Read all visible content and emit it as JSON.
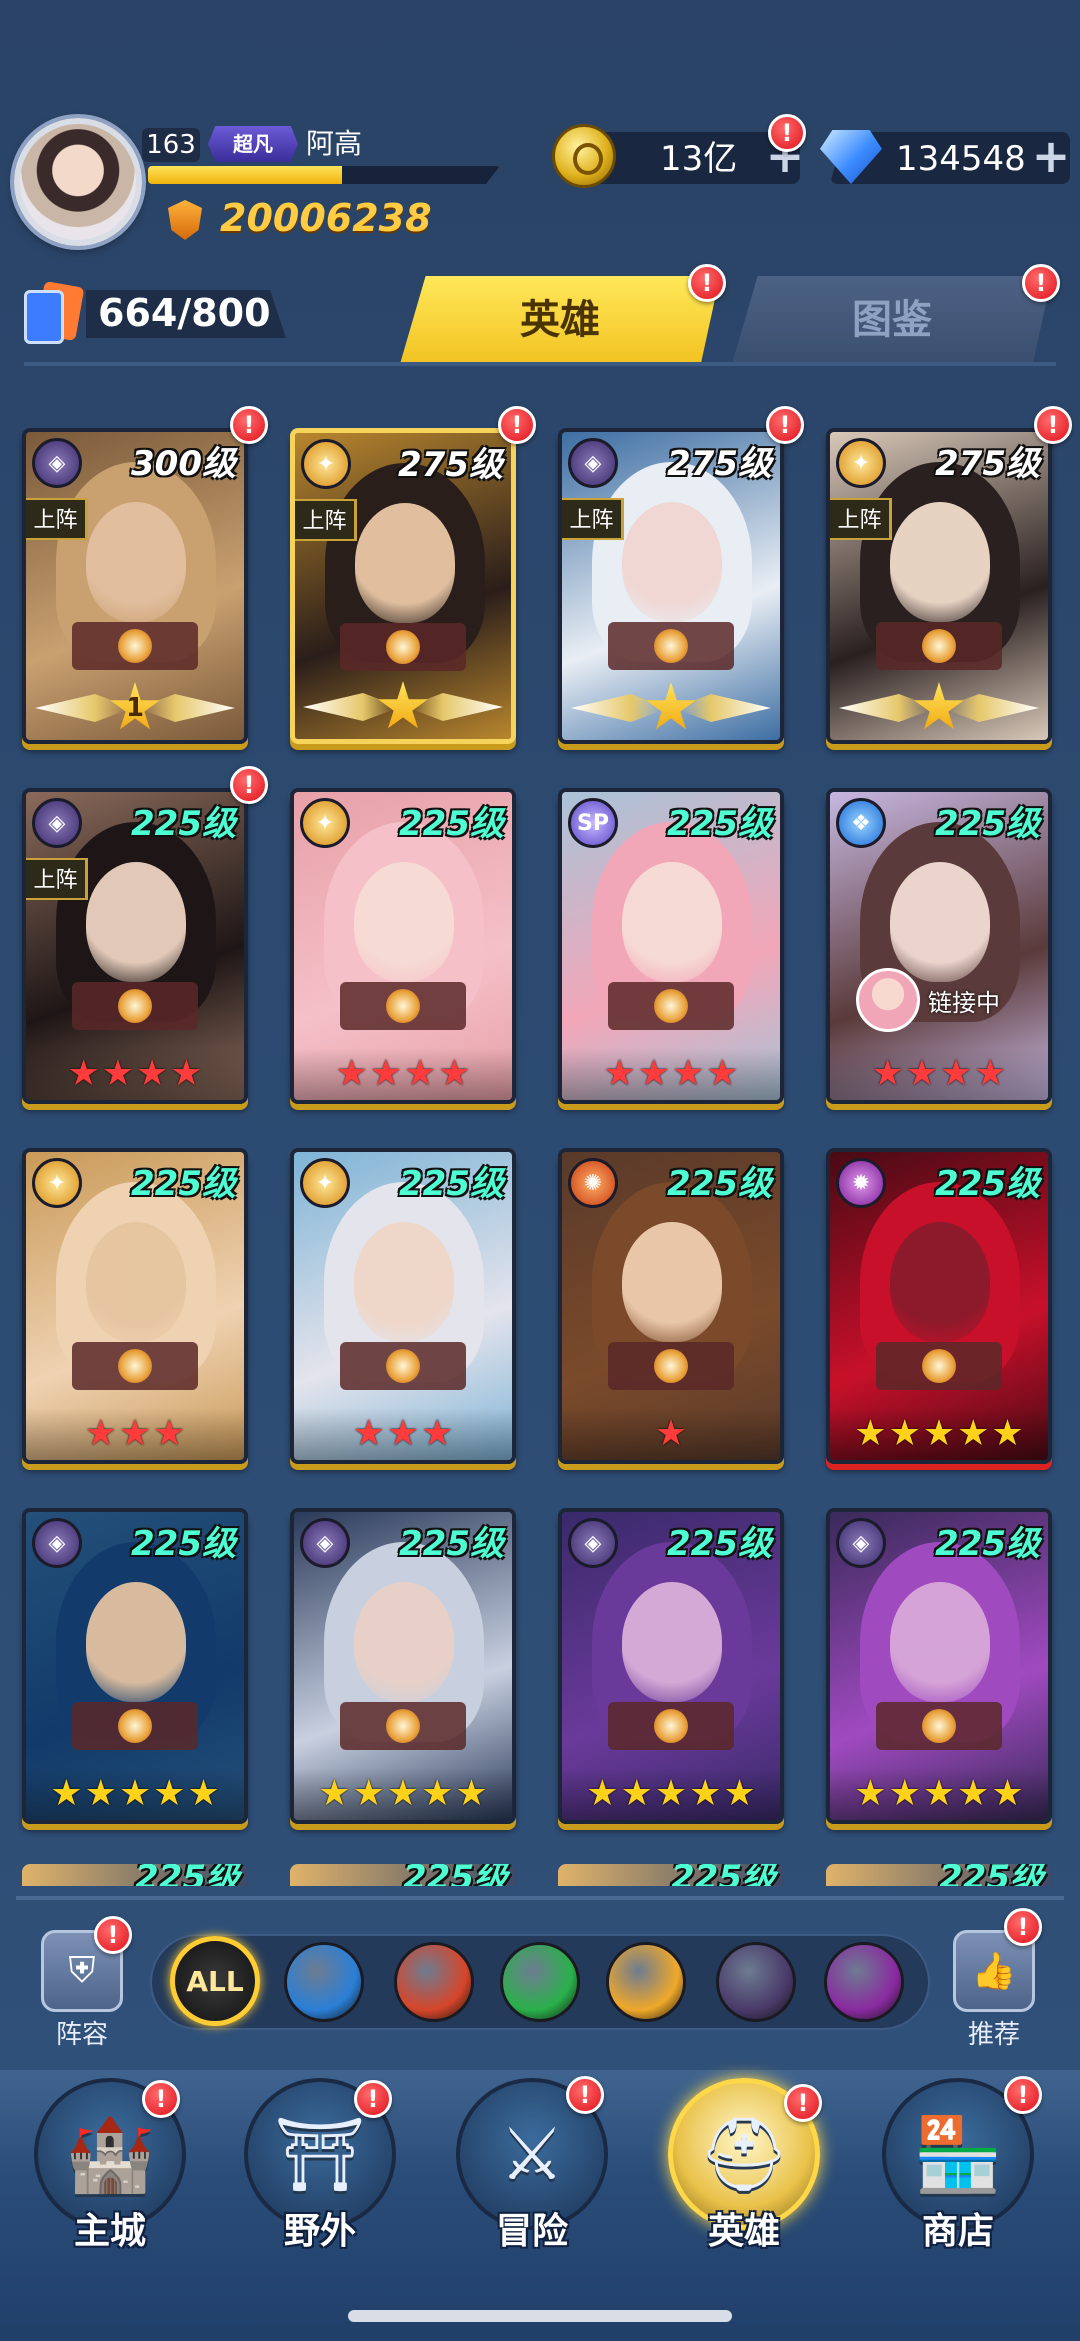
{
  "player": {
    "level": "163",
    "rank": "超凡",
    "name": "阿高",
    "xp_fraction": 0.55,
    "power": "20006238"
  },
  "currency": {
    "gold": "13亿",
    "gems": "134548"
  },
  "collection": {
    "count": "664/800"
  },
  "tabs": {
    "heroes": "英雄",
    "atlas": "图鉴"
  },
  "heroes": [
    {
      "level": "300级",
      "class_icon": "dark-icon",
      "on_team": "上阵",
      "rank_star": "1",
      "stars": 0,
      "star_color": "none",
      "colors": [
        "#7a5a3a",
        "#c9a070",
        "#e2bfa0"
      ],
      "frame": "normal"
    },
    {
      "level": "275级",
      "class_icon": "light-icon",
      "on_team": "上阵",
      "rank_star": "",
      "stars": 0,
      "star_color": "none",
      "colors": [
        "#b8862e",
        "#2a1e1a",
        "#e9c7a5"
      ],
      "frame": "gold"
    },
    {
      "level": "275级",
      "class_icon": "dark-icon",
      "on_team": "上阵",
      "rank_star": "",
      "stars": 0,
      "star_color": "none",
      "colors": [
        "#3d6ea3",
        "#e9eef4",
        "#f0d6d2"
      ],
      "frame": "normal"
    },
    {
      "level": "275级",
      "class_icon": "light-icon",
      "on_team": "上阵",
      "rank_star": "",
      "stars": 0,
      "star_color": "none",
      "colors": [
        "#d8c8b8",
        "#2a2020",
        "#f1dccb"
      ],
      "frame": "normal"
    },
    {
      "level": "225级",
      "class_icon": "dark-icon",
      "on_team": "上阵",
      "rank_star": "",
      "stars": 4,
      "star_color": "red",
      "colors": [
        "#8a6a5a",
        "#1e1616",
        "#ecd2c0"
      ],
      "frame": "normal"
    },
    {
      "level": "225级",
      "class_icon": "light-icon",
      "on_team": "",
      "rank_star": "",
      "stars": 4,
      "star_color": "red",
      "colors": [
        "#e7a0a8",
        "#f5c0c8",
        "#f6dcd4"
      ],
      "frame": "normal"
    },
    {
      "level": "225级",
      "class_icon": "sp-icon",
      "on_team": "",
      "rank_star": "",
      "stars": 4,
      "star_color": "red",
      "colors": [
        "#a9c3d8",
        "#f2a7b8",
        "#f6dcd6"
      ],
      "frame": "normal"
    },
    {
      "level": "225级",
      "class_icon": "water-icon",
      "on_team": "",
      "rank_star": "",
      "stars": 4,
      "star_color": "red",
      "colors": [
        "#c7b7e0",
        "#5a3a3a",
        "#f1dcd4"
      ],
      "frame": "normal",
      "link_text": "链接中"
    },
    {
      "level": "225级",
      "class_icon": "light-icon",
      "on_team": "",
      "rank_star": "",
      "stars": 3,
      "star_color": "red",
      "colors": [
        "#c99a58",
        "#efd2b2",
        "#e6c4a0"
      ],
      "frame": "normal"
    },
    {
      "level": "225级",
      "class_icon": "light-icon",
      "on_team": "",
      "rank_star": "",
      "stars": 3,
      "star_color": "red",
      "colors": [
        "#7fb4d6",
        "#e4e4ec",
        "#efd6c6"
      ],
      "frame": "normal"
    },
    {
      "level": "225级",
      "class_icon": "fire-icon",
      "on_team": "",
      "rank_star": "",
      "stars": 1,
      "star_color": "red",
      "colors": [
        "#5a3a2a",
        "#7a4a2a",
        "#f0cdb0"
      ],
      "frame": "normal"
    },
    {
      "level": "225级",
      "class_icon": "void-icon",
      "on_team": "",
      "rank_star": "",
      "stars": 5,
      "star_color": "gold",
      "colors": [
        "#4a0a14",
        "#c8102a",
        "#8a1a2a"
      ],
      "frame": "red"
    },
    {
      "level": "225级",
      "class_icon": "dark-icon",
      "on_team": "",
      "rank_star": "",
      "stars": 5,
      "star_color": "gold",
      "colors": [
        "#24507a",
        "#123a6a",
        "#e2c2a2"
      ],
      "frame": "normal"
    },
    {
      "level": "225级",
      "class_icon": "dark-icon",
      "on_team": "",
      "rank_star": "",
      "stars": 5,
      "star_color": "gold",
      "colors": [
        "#2a3a5a",
        "#c8d0e0",
        "#e9d0c6"
      ],
      "frame": "normal"
    },
    {
      "level": "225级",
      "class_icon": "dark-icon",
      "on_team": "",
      "rank_star": "",
      "stars": 5,
      "star_color": "gold",
      "colors": [
        "#3a2a6a",
        "#6a3a9a",
        "#d8b0d8"
      ],
      "frame": "normal"
    },
    {
      "level": "225级",
      "class_icon": "dark-icon",
      "on_team": "",
      "rank_star": "",
      "stars": 5,
      "star_color": "gold",
      "colors": [
        "#3a2a5a",
        "#a04ac0",
        "#d8a8d8"
      ],
      "frame": "normal"
    }
  ],
  "partial_row": [
    "225级",
    "225级",
    "225级",
    "225级"
  ],
  "sidebar": {
    "lineup": "阵容",
    "recommend": "推荐"
  },
  "filters": [
    {
      "name": "all-filter",
      "label": "ALL",
      "color": "#111111"
    },
    {
      "name": "water-filter-icon",
      "label": "",
      "color": "#2a7fd6"
    },
    {
      "name": "fire-filter-icon",
      "label": "",
      "color": "#d6462a"
    },
    {
      "name": "wind-filter-icon",
      "label": "",
      "color": "#2ab04a"
    },
    {
      "name": "light-filter-icon",
      "label": "",
      "color": "#f0a82a"
    },
    {
      "name": "dark-filter-icon",
      "label": "",
      "color": "#4a3a6a"
    },
    {
      "name": "void-filter-icon",
      "label": "",
      "color": "#8a2aa0"
    }
  ],
  "nav": {
    "city": "主城",
    "wild": "野外",
    "adventure": "冒险",
    "heroes": "英雄",
    "shop": "商店"
  }
}
